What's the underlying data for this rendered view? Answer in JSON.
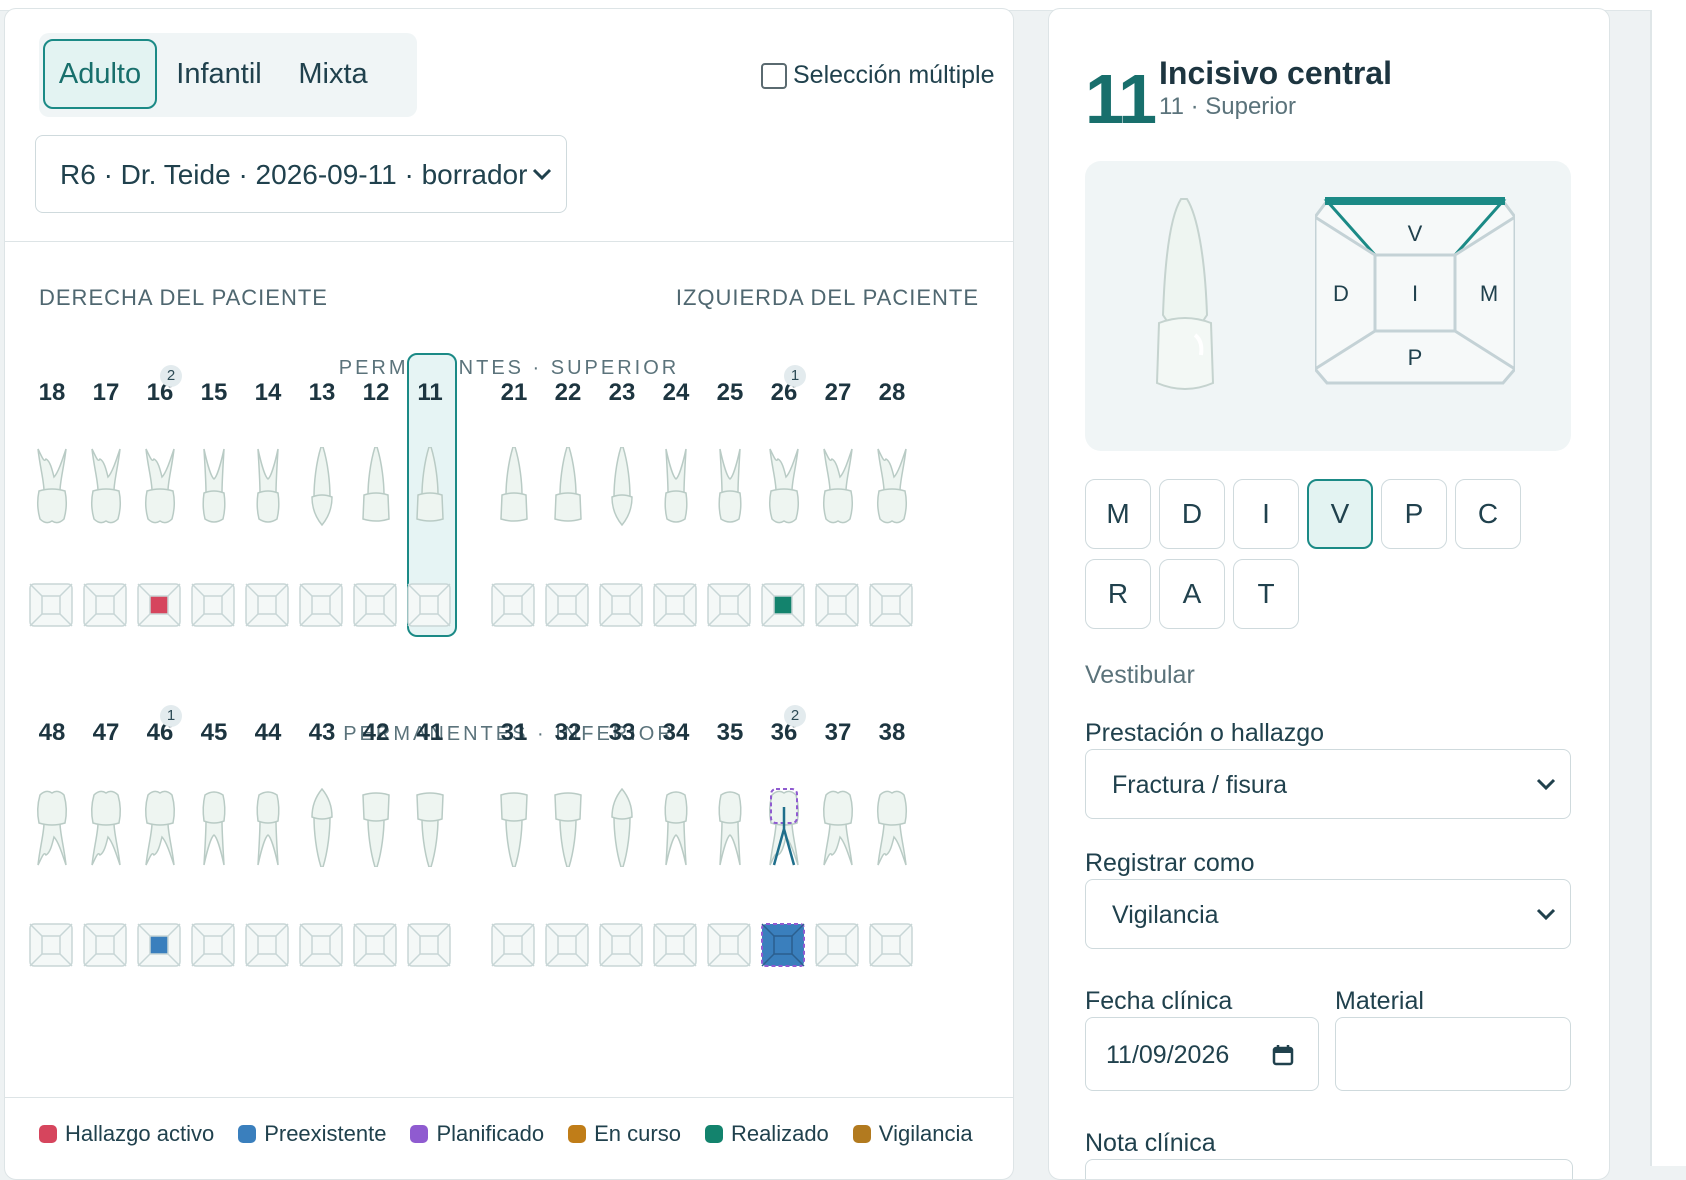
{
  "dentition_tabs": [
    {
      "label": "Adulto",
      "active": true
    },
    {
      "label": "Infantil",
      "active": false
    },
    {
      "label": "Mixta",
      "active": false
    }
  ],
  "multi_select_label": "Selección múltiple",
  "session_select": "R6 · Dr. Teide · 2026-09-11 · borrador",
  "side_labels": {
    "right": "DERECHA DEL PACIENTE",
    "left": "IZQUIERDA DEL PACIENTE"
  },
  "arch_labels": {
    "upper": "PERMANENTES · SUPERIOR",
    "lower": "PERMANENTES · INFERIOR"
  },
  "upper_teeth": [
    {
      "num": "18",
      "type": "molar"
    },
    {
      "num": "17",
      "type": "molar"
    },
    {
      "num": "16",
      "type": "molar",
      "badge": "2",
      "mark": "#d6455d"
    },
    {
      "num": "15",
      "type": "premolar"
    },
    {
      "num": "14",
      "type": "premolar"
    },
    {
      "num": "13",
      "type": "canine"
    },
    {
      "num": "12",
      "type": "incisor"
    },
    {
      "num": "11",
      "type": "incisor",
      "selected": true
    },
    {
      "num": "21",
      "type": "incisor"
    },
    {
      "num": "22",
      "type": "incisor"
    },
    {
      "num": "23",
      "type": "canine"
    },
    {
      "num": "24",
      "type": "premolar"
    },
    {
      "num": "25",
      "type": "premolar"
    },
    {
      "num": "26",
      "type": "molar",
      "badge": "1",
      "mark": "#13836d"
    },
    {
      "num": "27",
      "type": "molar"
    },
    {
      "num": "28",
      "type": "molar"
    }
  ],
  "lower_teeth": [
    {
      "num": "48",
      "type": "molar"
    },
    {
      "num": "47",
      "type": "molar"
    },
    {
      "num": "46",
      "type": "molar",
      "badge": "1",
      "mark": "#3a7fbd"
    },
    {
      "num": "45",
      "type": "premolar"
    },
    {
      "num": "44",
      "type": "premolar"
    },
    {
      "num": "43",
      "type": "canine"
    },
    {
      "num": "42",
      "type": "incisor"
    },
    {
      "num": "41",
      "type": "incisor"
    },
    {
      "num": "31",
      "type": "incisor"
    },
    {
      "num": "32",
      "type": "incisor"
    },
    {
      "num": "33",
      "type": "canine"
    },
    {
      "num": "34",
      "type": "premolar"
    },
    {
      "num": "35",
      "type": "premolar"
    },
    {
      "num": "36",
      "type": "molar",
      "badge": "2",
      "mark": "#3a7fbd",
      "fullmark": true,
      "planned": true
    },
    {
      "num": "37",
      "type": "molar"
    },
    {
      "num": "38",
      "type": "molar"
    }
  ],
  "legend": [
    {
      "label": "Hallazgo activo",
      "color": "#d6455d"
    },
    {
      "label": "Preexistente",
      "color": "#3a7fbd"
    },
    {
      "label": "Planificado",
      "color": "#8f5bd0"
    },
    {
      "label": "En curso",
      "color": "#c07d18"
    },
    {
      "label": "Realizado",
      "color": "#13836d"
    },
    {
      "label": "Vigilancia",
      "color": "#b27a1f"
    }
  ],
  "detail": {
    "number": "11",
    "name": "Incisivo central",
    "subtitle": "11 · Superior",
    "diagram_letters": {
      "top": "V",
      "left": "D",
      "center": "I",
      "right": "M",
      "bottom": "P"
    },
    "surfaces": [
      {
        "label": "M"
      },
      {
        "label": "D"
      },
      {
        "label": "I"
      },
      {
        "label": "V",
        "active": true
      },
      {
        "label": "P"
      },
      {
        "label": "C"
      },
      {
        "label": "R"
      },
      {
        "label": "A"
      },
      {
        "label": "T"
      }
    ],
    "surface_name": "Vestibular",
    "procedure_label": "Prestación o hallazgo",
    "procedure_value": "Fractura / fisura",
    "register_label": "Registrar como",
    "register_value": "Vigilancia",
    "date_label": "Fecha clínica",
    "date_value": "11/09/2026",
    "material_label": "Material",
    "material_value": "",
    "note_label": "Nota clínica"
  }
}
